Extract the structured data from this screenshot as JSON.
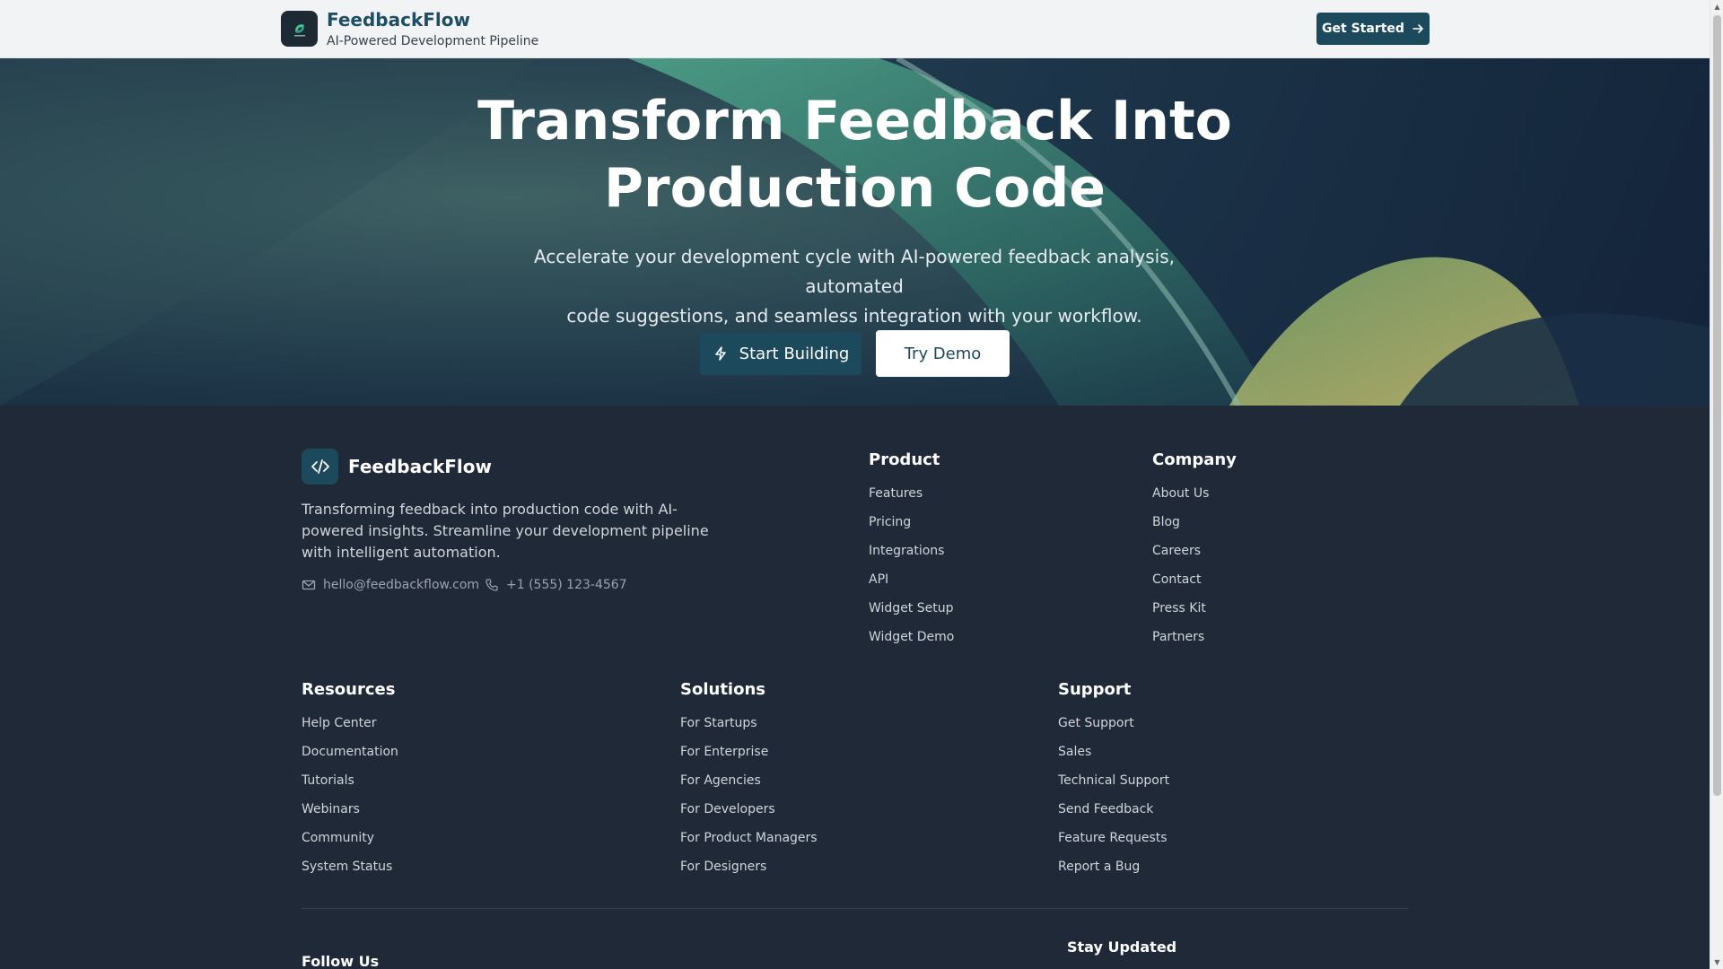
{
  "header": {
    "brand_title": "FeedbackFlow",
    "brand_subtitle": "AI-Powered Development Pipeline",
    "cta_label": "Get Started"
  },
  "hero": {
    "title_line1": "Transform Feedback Into",
    "title_line2": "Production Code",
    "subtitle_line1": "Accelerate your development cycle with AI-powered feedback analysis, automated",
    "subtitle_line2": "code suggestions, and seamless integration with your workflow.",
    "primary_button": "Start Building",
    "secondary_button": "Try Demo"
  },
  "footer": {
    "brand": "FeedbackFlow",
    "description": "Transforming feedback into production code with AI-powered insights. Streamline your development pipeline with intelligent automation.",
    "email": "hello@feedbackflow.com",
    "phone": "+1 (555) 123-4567",
    "columns": {
      "product": {
        "title": "Product",
        "links": [
          "Features",
          "Pricing",
          "Integrations",
          "API",
          "Widget Setup",
          "Widget Demo"
        ]
      },
      "company": {
        "title": "Company",
        "links": [
          "About Us",
          "Blog",
          "Careers",
          "Contact",
          "Press Kit",
          "Partners"
        ]
      },
      "resources": {
        "title": "Resources",
        "links": [
          "Help Center",
          "Documentation",
          "Tutorials",
          "Webinars",
          "Community",
          "System Status"
        ]
      },
      "solutions": {
        "title": "Solutions",
        "links": [
          "For Startups",
          "For Enterprise",
          "For Agencies",
          "For Developers",
          "For Product Managers",
          "For Designers"
        ]
      },
      "support": {
        "title": "Support",
        "links": [
          "Get Support",
          "Sales",
          "Technical Support",
          "Send Feedback",
          "Feature Requests",
          "Report a Bug"
        ]
      }
    },
    "follow_us": "Follow Us",
    "stay_updated": "Stay Updated"
  },
  "icons": {
    "header_cta": "arrow-right-icon",
    "primary_button": "zap-icon",
    "footer_logo": "code-icon",
    "email": "mail-icon",
    "phone": "phone-icon"
  },
  "colors": {
    "primary": "#1c4a5c",
    "footer_bg": "#1f2937",
    "header_bg": "#f1f3f4"
  }
}
